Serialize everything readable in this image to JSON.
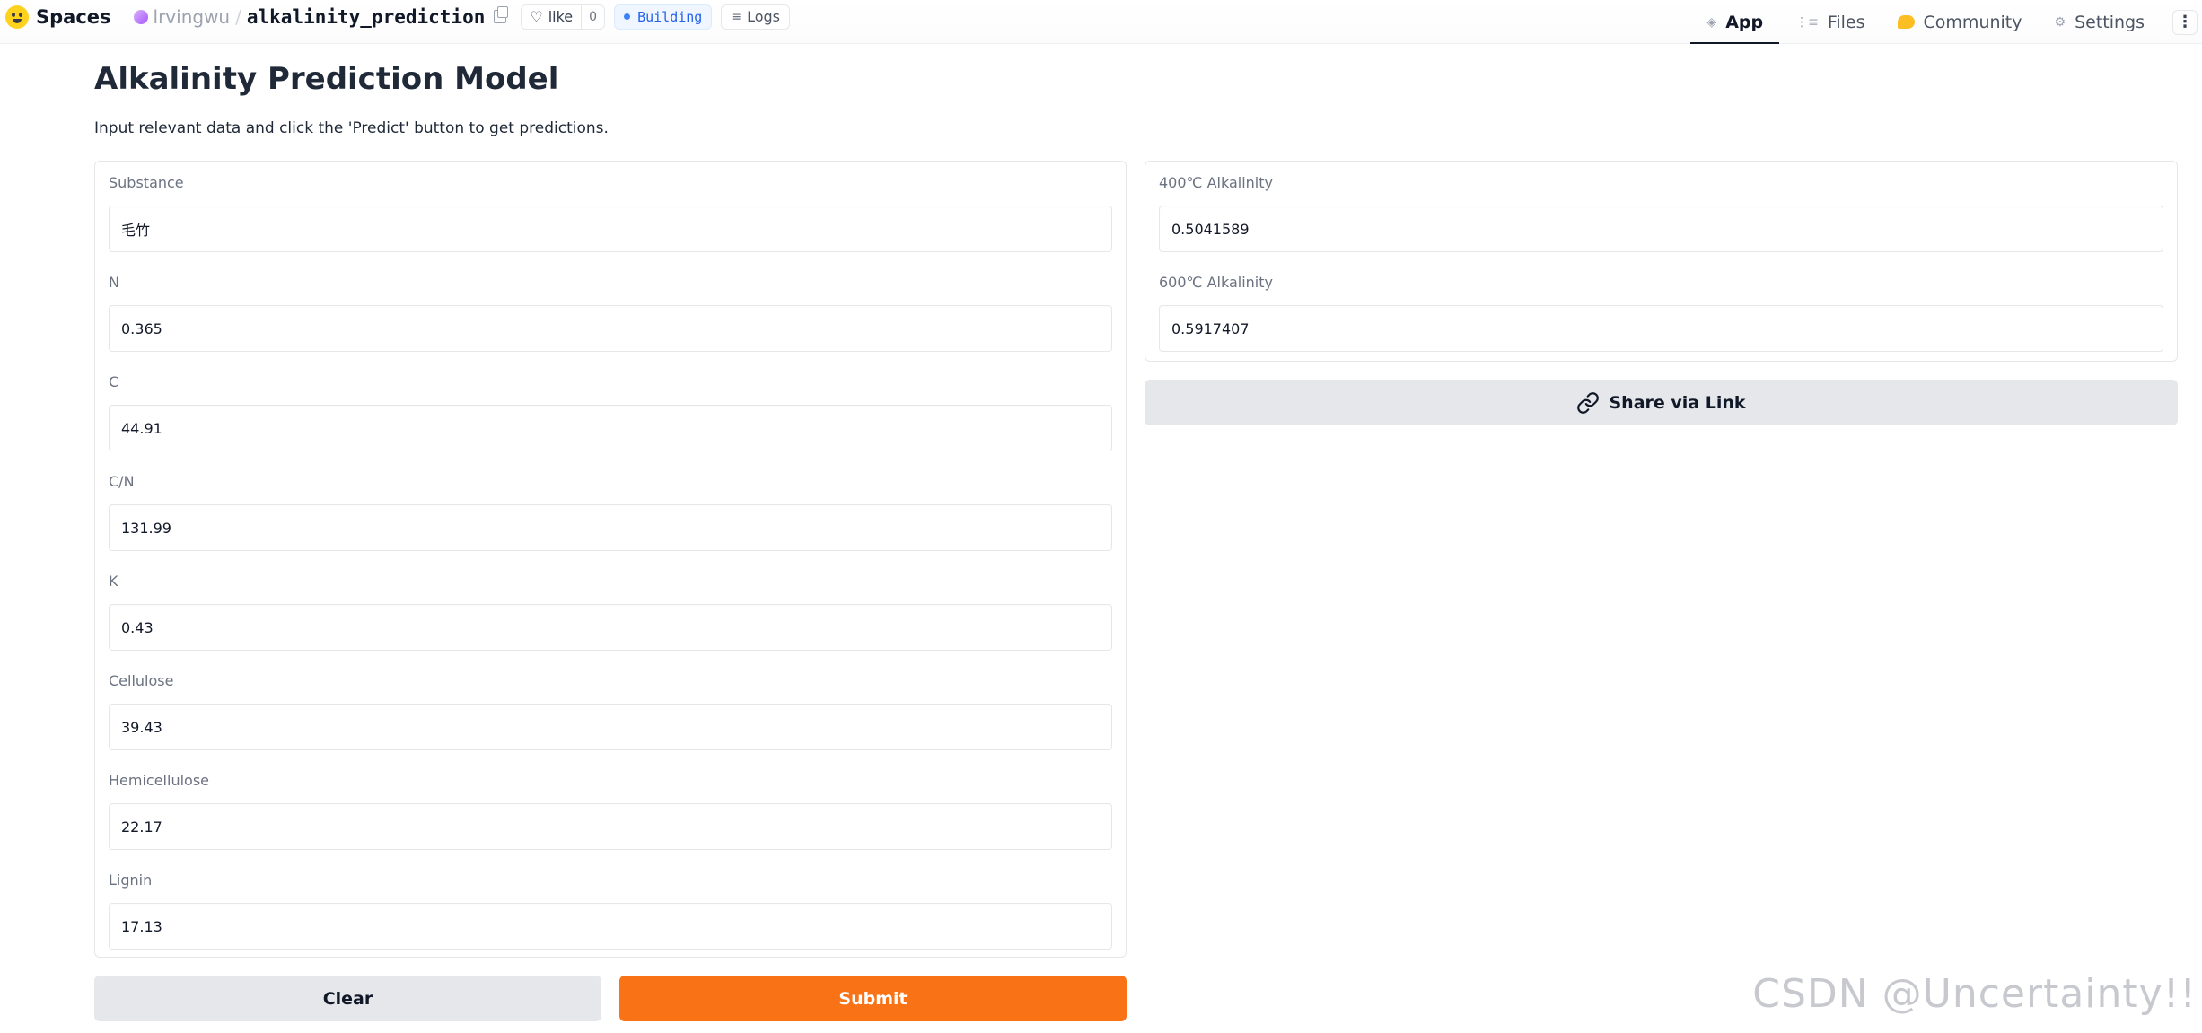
{
  "topbar": {
    "spaces_label": "Spaces",
    "user": "lrvingwu",
    "separator": "/",
    "repo": "alkalinity_prediction",
    "like_label": "like",
    "like_count": "0",
    "status": "Building",
    "logs_label": "Logs",
    "tabs": [
      {
        "label": "App",
        "icon": "cube-icon"
      },
      {
        "label": "Files",
        "icon": "files-icon"
      },
      {
        "label": "Community",
        "icon": "community-icon"
      },
      {
        "label": "Settings",
        "icon": "gear-icon"
      }
    ],
    "more": "⋮"
  },
  "app": {
    "title": "Alkalinity Prediction Model",
    "description": "Input relevant data and click the 'Predict' button to get predictions."
  },
  "inputs": [
    {
      "label": "Substance",
      "value": "毛竹"
    },
    {
      "label": "N",
      "value": "0.365"
    },
    {
      "label": "C",
      "value": "44.91"
    },
    {
      "label": "C/N",
      "value": "131.99"
    },
    {
      "label": "K",
      "value": "0.43"
    },
    {
      "label": "Cellulose",
      "value": "39.43"
    },
    {
      "label": "Hemicellulose",
      "value": "22.17"
    },
    {
      "label": "Lignin",
      "value": "17.13"
    }
  ],
  "outputs": [
    {
      "label": "400℃ Alkalinity",
      "value": "0.5041589"
    },
    {
      "label": "600℃ Alkalinity",
      "value": "0.5917407"
    }
  ],
  "buttons": {
    "clear": "Clear",
    "submit": "Submit",
    "share": "Share via Link"
  },
  "watermark": "CSDN @Uncertainty!!",
  "colors": {
    "primary": "#f97316",
    "secondary": "#e5e7eb",
    "status_blue": "#2563eb"
  }
}
